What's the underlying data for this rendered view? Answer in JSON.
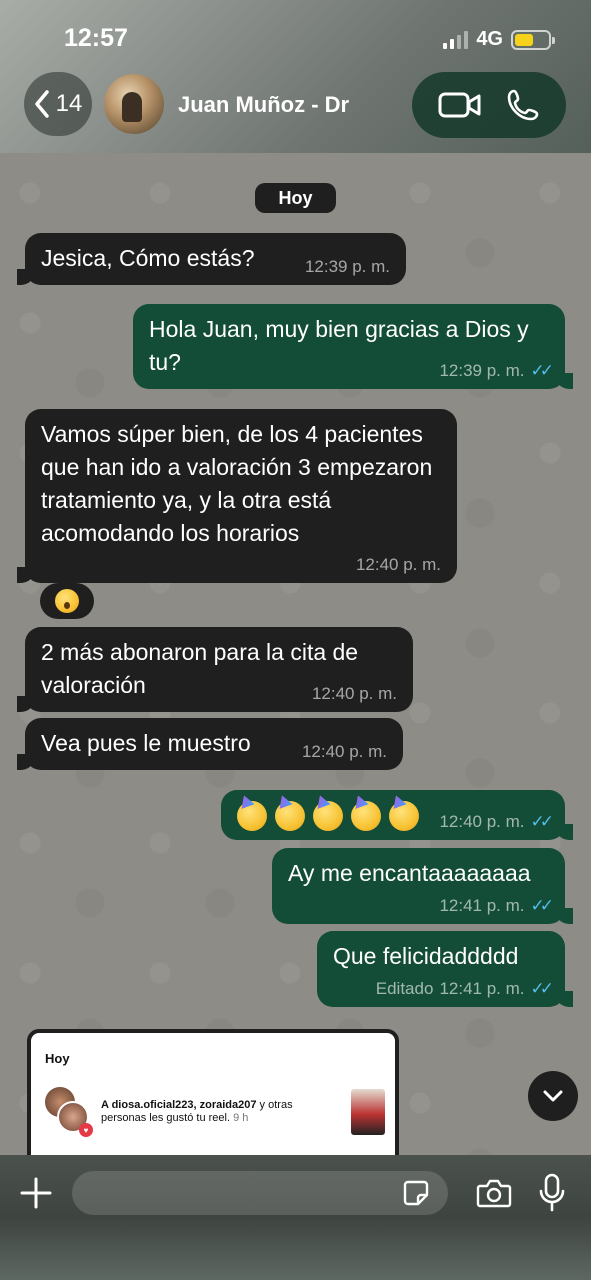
{
  "status_bar": {
    "time": "12:57",
    "network": "4G"
  },
  "header": {
    "back_count": "14",
    "contact_name": "Juan Muñoz - Dr"
  },
  "chat": {
    "date_chip": "Hoy",
    "messages": [
      {
        "dir": "in",
        "text": "Jesica, Cómo estás?",
        "time": "12:39 p. m."
      },
      {
        "dir": "out",
        "text": "Hola Juan, muy bien gracias a Dios y tu?",
        "time": "12:39 p. m."
      },
      {
        "dir": "in",
        "text": "Vamos súper bien, de los 4 pacientes que han ido a valoración 3 empezaron tratamiento ya, y la otra está acomodando los horarios",
        "time": "12:40 p. m."
      },
      {
        "dir": "in",
        "text": "2 más abonaron para la cita de valoración",
        "time": "12:40 p. m."
      },
      {
        "dir": "in",
        "text": "Vea pues le muestro",
        "time": "12:40 p. m."
      },
      {
        "dir": "out",
        "text": "",
        "time": "12:40 p. m."
      },
      {
        "dir": "out",
        "text": "Ay me encantaaaaaaaa",
        "time": "12:41 p. m."
      },
      {
        "dir": "out",
        "text": "Que felicidaddddd",
        "time": "12:41 p. m.",
        "edited_label": "Editado"
      }
    ],
    "reel_card": {
      "title": "Hoy",
      "users": "A diosa.oficial223, zoraida207",
      "rest": " y otras personas les gustó tu reel.",
      "time": "9 h"
    }
  },
  "composer": {
    "placeholder": ""
  },
  "colors": {
    "incoming": "#1f1f1f",
    "outgoing": "#134d37",
    "read_ticks": "#53bdeb"
  },
  "icons": [
    "chevron-left-icon",
    "video-call-icon",
    "phone-icon",
    "plus-icon",
    "sticker-icon",
    "camera-icon",
    "mic-icon",
    "chevron-down-icon",
    "heart-icon"
  ]
}
